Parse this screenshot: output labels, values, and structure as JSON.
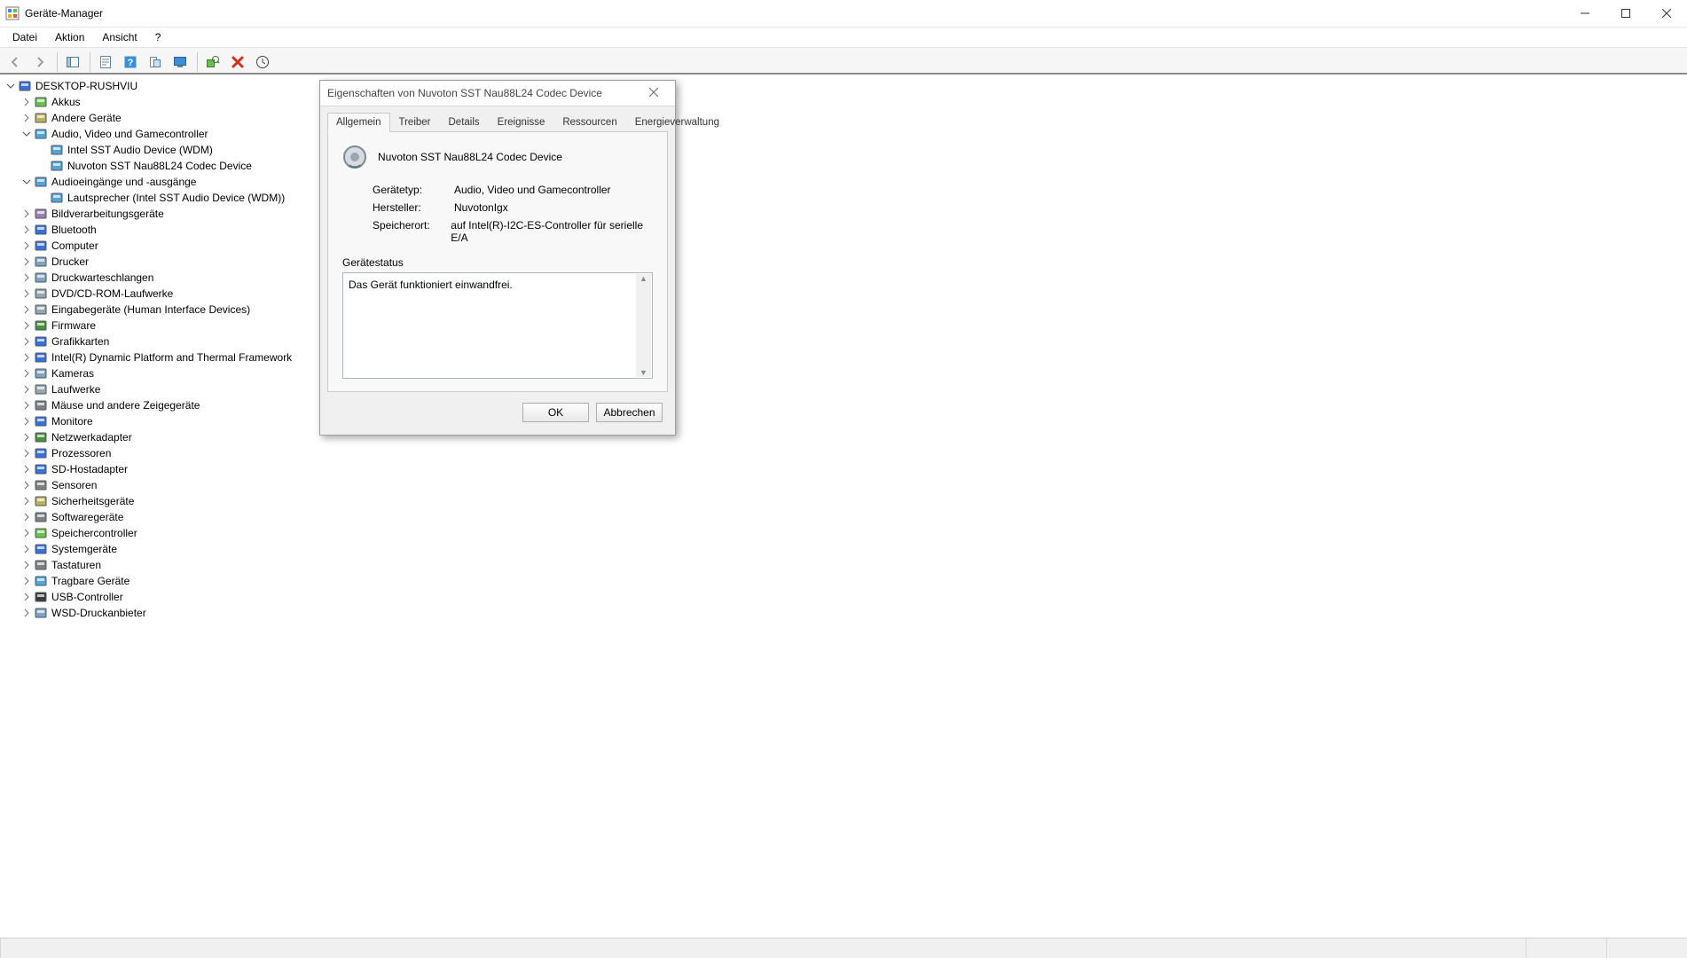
{
  "window": {
    "title": "Geräte-Manager"
  },
  "menu": {
    "file": "Datei",
    "action": "Aktion",
    "view": "Ansicht",
    "help": "?"
  },
  "tree": {
    "root": "DESKTOP-RUSHVIU",
    "nodes": [
      {
        "label": "Akkus",
        "icon": "battery",
        "expanded": false
      },
      {
        "label": "Andere Geräte",
        "icon": "other",
        "expanded": false
      },
      {
        "label": "Audio, Video und Gamecontroller",
        "icon": "audio",
        "expanded": true,
        "children": [
          {
            "label": "Intel SST Audio Device (WDM)",
            "icon": "audio"
          },
          {
            "label": "Nuvoton SST Nau88L24 Codec Device",
            "icon": "audio",
            "selected": true
          }
        ]
      },
      {
        "label": "Audioeingänge und -ausgänge",
        "icon": "audio",
        "expanded": true,
        "children": [
          {
            "label": "Lautsprecher (Intel SST Audio Device (WDM))",
            "icon": "audio"
          }
        ]
      },
      {
        "label": "Bildverarbeitungsgeräte",
        "icon": "imaging"
      },
      {
        "label": "Bluetooth",
        "icon": "bluetooth"
      },
      {
        "label": "Computer",
        "icon": "computer"
      },
      {
        "label": "Drucker",
        "icon": "printer"
      },
      {
        "label": "Druckwarteschlangen",
        "icon": "printqueue"
      },
      {
        "label": "DVD/CD-ROM-Laufwerke",
        "icon": "dvd"
      },
      {
        "label": "Eingabegeräte (Human Interface Devices)",
        "icon": "hid"
      },
      {
        "label": "Firmware",
        "icon": "firmware"
      },
      {
        "label": "Grafikkarten",
        "icon": "display"
      },
      {
        "label": "Intel(R) Dynamic Platform and Thermal Framework",
        "icon": "chip"
      },
      {
        "label": "Kameras",
        "icon": "camera"
      },
      {
        "label": "Laufwerke",
        "icon": "disk"
      },
      {
        "label": "Mäuse und andere Zeigegeräte",
        "icon": "mouse"
      },
      {
        "label": "Monitore",
        "icon": "monitor"
      },
      {
        "label": "Netzwerkadapter",
        "icon": "network"
      },
      {
        "label": "Prozessoren",
        "icon": "cpu"
      },
      {
        "label": "SD-Hostadapter",
        "icon": "sd"
      },
      {
        "label": "Sensoren",
        "icon": "sensor"
      },
      {
        "label": "Sicherheitsgeräte",
        "icon": "security"
      },
      {
        "label": "Softwaregeräte",
        "icon": "software"
      },
      {
        "label": "Speichercontroller",
        "icon": "storage"
      },
      {
        "label": "Systemgeräte",
        "icon": "system"
      },
      {
        "label": "Tastaturen",
        "icon": "keyboard"
      },
      {
        "label": "Tragbare Geräte",
        "icon": "portable"
      },
      {
        "label": "USB-Controller",
        "icon": "usb"
      },
      {
        "label": "WSD-Druckanbieter",
        "icon": "wsd"
      }
    ]
  },
  "dialog": {
    "title": "Eigenschaften von Nuvoton SST Nau88L24 Codec Device",
    "tabs": [
      {
        "id": "general",
        "label": "Allgemein",
        "active": true
      },
      {
        "id": "driver",
        "label": "Treiber"
      },
      {
        "id": "details",
        "label": "Details"
      },
      {
        "id": "events",
        "label": "Ereignisse"
      },
      {
        "id": "resources",
        "label": "Ressourcen"
      },
      {
        "id": "power",
        "label": "Energieverwaltung"
      }
    ],
    "device_name": "Nuvoton SST Nau88L24 Codec Device",
    "rows": {
      "type_label": "Gerätetyp:",
      "type_value": "Audio, Video und Gamecontroller",
      "vendor_label": "Hersteller:",
      "vendor_value": "NuvotonIgx",
      "loc_label": "Speicherort:",
      "loc_value": "auf Intel(R)-I2C-ES-Controller für serielle E/A"
    },
    "status_label": "Gerätestatus",
    "status_text": "Das Gerät funktioniert einwandfrei.",
    "ok": "OK",
    "cancel": "Abbrechen"
  }
}
